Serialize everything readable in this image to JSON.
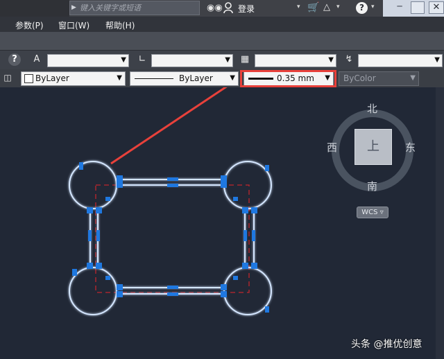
{
  "titlebar": {
    "search_placeholder": "键入关键字或短语",
    "login_label": "登录"
  },
  "menu": {
    "items": [
      "参数(P)",
      "窗口(W)",
      "帮助(H)"
    ]
  },
  "properties": {
    "layer_color": "ByLayer",
    "linetype": "ByLayer",
    "lineweight": "0.35 mm",
    "plot_style": "ByColor"
  },
  "viewcube": {
    "north": "北",
    "south": "南",
    "east": "东",
    "west": "西",
    "face": "上",
    "wcs_label": "WCS"
  },
  "watermark": "头条 @推优创意",
  "colors": {
    "canvas_bg": "#212836",
    "highlight": "#e8413b",
    "geometry": "#cfe3ff",
    "grip": "#1f78e0",
    "hidden_line": "#c0262c"
  }
}
